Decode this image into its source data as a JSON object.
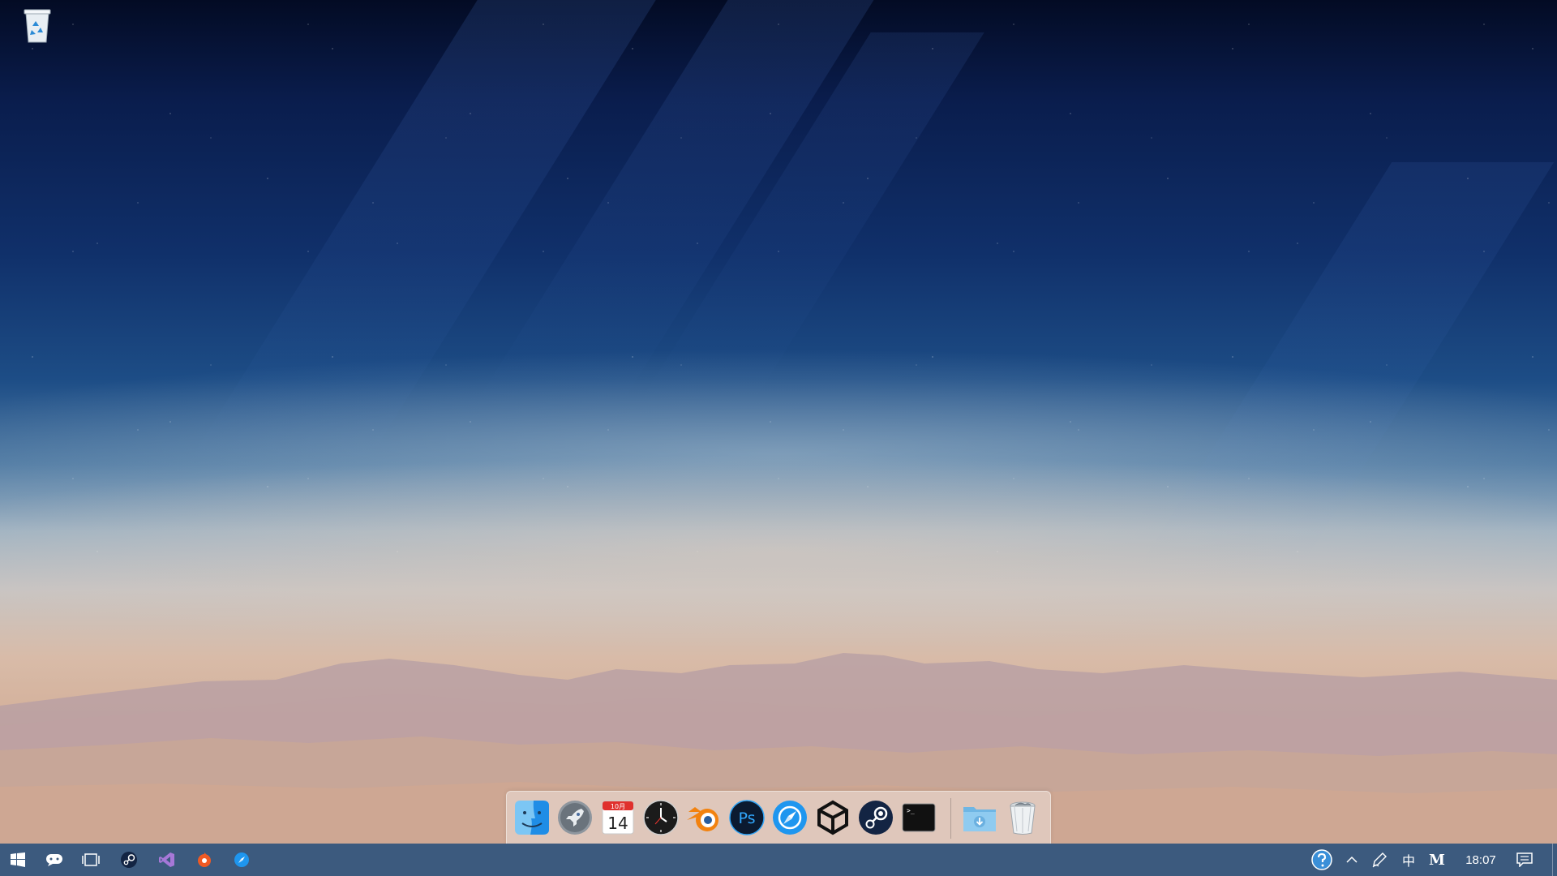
{
  "desktop": {
    "icons": [
      {
        "name": "recycle-bin-icon"
      }
    ]
  },
  "dock": {
    "apps": [
      {
        "name": "finder-icon",
        "running": true
      },
      {
        "name": "launchpad-rocket-icon",
        "running": false
      },
      {
        "name": "calendar-icon",
        "month": "10月",
        "day": "14",
        "running": false
      },
      {
        "name": "clock-icon",
        "running": false
      },
      {
        "name": "blender-icon",
        "running": false
      },
      {
        "name": "photoshop-icon",
        "label": "Ps",
        "running": false
      },
      {
        "name": "browser-compass-icon",
        "running": false
      },
      {
        "name": "unity-icon",
        "running": false
      },
      {
        "name": "steam-icon",
        "running": false
      },
      {
        "name": "terminal-icon",
        "prompt": ">_",
        "running": false
      }
    ],
    "stack": [
      {
        "name": "downloads-folder-icon"
      },
      {
        "name": "trash-icon"
      }
    ]
  },
  "taskbar": {
    "start": {
      "name": "windows-start-icon"
    },
    "pinned": [
      {
        "name": "cortana-chat-icon"
      },
      {
        "name": "task-view-icon"
      },
      {
        "name": "steam-icon"
      },
      {
        "name": "visual-studio-icon"
      },
      {
        "name": "app-orange-icon"
      },
      {
        "name": "browser-compass-icon"
      }
    ],
    "tray": {
      "items": [
        {
          "name": "help-icon"
        },
        {
          "name": "chevron-up-icon"
        },
        {
          "name": "pen-icon"
        }
      ],
      "ime_mode": "中",
      "ime_extra": "M",
      "clock": "18:07",
      "notification": {
        "name": "notification-icon"
      }
    }
  },
  "colors": {
    "taskbar": "#3c5a7e",
    "dock_background": "#ece2dc"
  }
}
